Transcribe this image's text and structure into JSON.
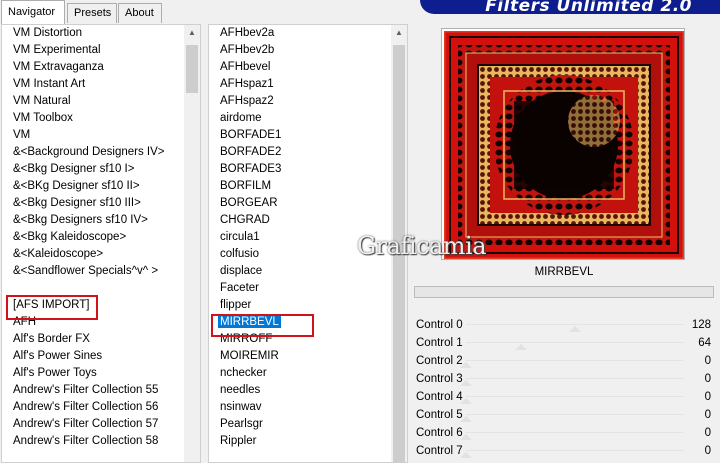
{
  "tabs": [
    {
      "label": "Navigator",
      "active": true
    },
    {
      "label": "Presets",
      "active": false
    },
    {
      "label": "About",
      "active": false
    }
  ],
  "banner": {
    "title": "Filters Unlimited 2.0"
  },
  "categories": [
    "VM Distortion",
    "VM Experimental",
    "VM Extravaganza",
    "VM Instant Art",
    "VM Natural",
    "VM Toolbox",
    "VM",
    "&<Background Designers IV>",
    "&<Bkg Designer sf10 I>",
    "&<BKg Designer sf10 II>",
    "&<Bkg Designer sf10 III>",
    "&<Bkg Designers sf10 IV>",
    "&<Bkg Kaleidoscope>",
    "&<Kaleidoscope>",
    "&<Sandflower Specials^v^ >",
    "",
    "[AFS IMPORT]",
    "AFH",
    "Alf's Border FX",
    "Alf's Power Sines",
    "Alf's Power Toys",
    "Andrew's Filter Collection 55",
    "Andrew's Filter Collection 56",
    "Andrew's Filter Collection 57",
    "Andrew's Filter Collection 58"
  ],
  "selected_category": "[AFS IMPORT]",
  "filters": [
    "AFHbev2a",
    "AFHbev2b",
    "AFHbevel",
    "AFHspaz1",
    "AFHspaz2",
    "airdome",
    "BORFADE1",
    "BORFADE2",
    "BORFADE3",
    "BORFILM",
    "BORGEAR",
    "CHGRAD",
    "circula1",
    "colfusio",
    "displace",
    "Faceter",
    "flipper",
    "MIRRBEVL",
    "MIRROFF",
    "MOIREMIR",
    "nchecker",
    "needles",
    "nsinwav",
    "Pearlsgr",
    "Rippler"
  ],
  "selected_filter": "MIRRBEVL",
  "watermark": "Graficamia",
  "filter_name": "MIRRBEVL",
  "controls": [
    {
      "label": "Control 0",
      "value": "128",
      "level": 0.5
    },
    {
      "label": "Control 1",
      "value": "64",
      "level": 0.25
    },
    {
      "label": "Control 2",
      "value": "0",
      "level": 0
    },
    {
      "label": "Control 3",
      "value": "0",
      "level": 0
    },
    {
      "label": "Control 4",
      "value": "0",
      "level": 0
    },
    {
      "label": "Control 5",
      "value": "0",
      "level": 0
    },
    {
      "label": "Control 6",
      "value": "0",
      "level": 0
    },
    {
      "label": "Control 7",
      "value": "0",
      "level": 0
    }
  ],
  "colors": {
    "selection": "#0078d7",
    "annotation": "#d0121b",
    "banner": "#0e1e8e",
    "preview_red": "#d4100d"
  }
}
